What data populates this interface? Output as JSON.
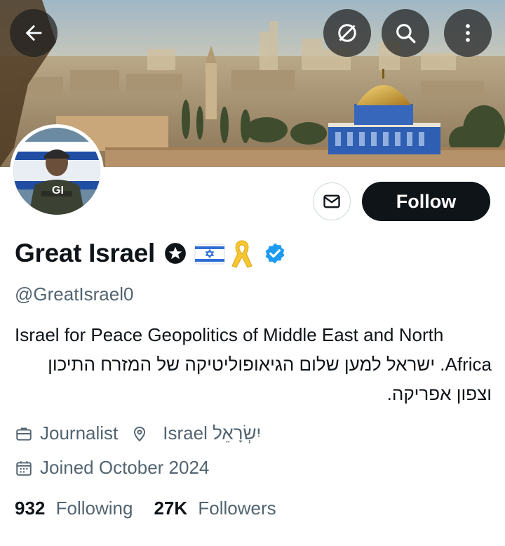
{
  "header": {
    "back_icon": "arrow-left-icon",
    "actions": [
      "mute-icon",
      "search-icon",
      "more-vertical-icon"
    ]
  },
  "profile": {
    "name": "Great Israel",
    "name_badges": [
      "star-badge-icon",
      "israel-flag-emoji",
      "yellow-ribbon-emoji"
    ],
    "verified": "verified-badge-icon",
    "handle": "@GreatIsrael0",
    "bio_line1": "Israel for Peace Geopolitics of Middle East and North",
    "bio_line2": "Africa. ישראל למען שלום הגיאופוליטיקה של המזרח התיכון",
    "bio_line3": "וצפון אפריקה.",
    "category": "Journalist",
    "location": "Israel יִשְׂרָאֵל",
    "joined": "Joined October 2024",
    "following_count": "932",
    "following_label": "Following",
    "followers_count": "27K",
    "followers_label": "Followers",
    "avatar_text": "GI"
  },
  "actions": {
    "follow_label": "Follow",
    "message_icon": "envelope-icon"
  },
  "colors": {
    "primary_text": "#0f1419",
    "secondary_text": "#536471",
    "follow_bg": "#0f1419",
    "verified_blue": "#1d9bf0",
    "border": "#cfd9de"
  }
}
